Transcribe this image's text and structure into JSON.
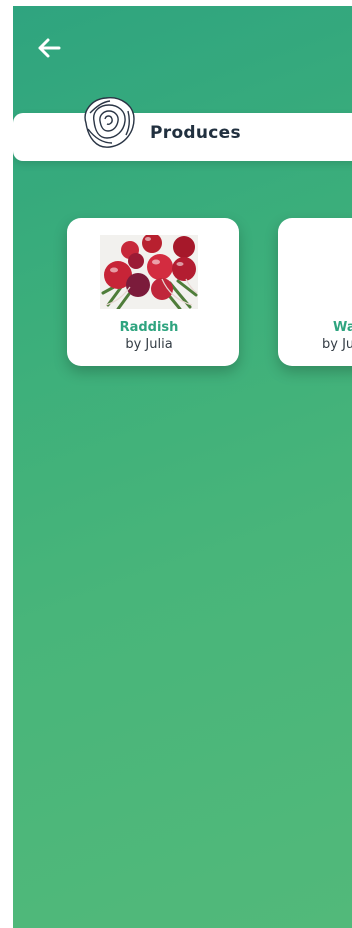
{
  "header": {
    "title": "Produces",
    "logo_icon": "cabbage-icon"
  },
  "nav": {
    "back_icon": "arrow-left-icon"
  },
  "produces": [
    {
      "name": "Raddish",
      "author": "by Julia",
      "image": "radish-photo"
    },
    {
      "name": "Wa",
      "author": "by Ju",
      "image": ""
    }
  ],
  "colors": {
    "background_top": "#2fa47f",
    "background_bottom": "#52b97a",
    "accent": "#2fa47f",
    "title_text": "#21303f"
  }
}
